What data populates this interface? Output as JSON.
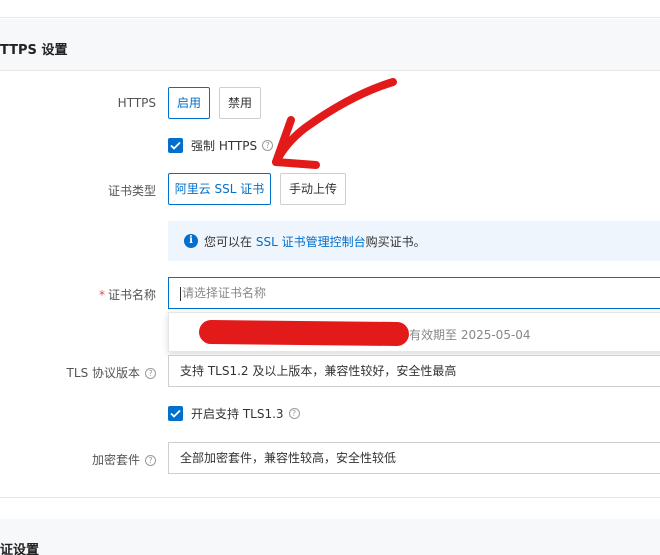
{
  "https_section": {
    "title": "TTPS 设置",
    "https_label": "HTTPS",
    "enable_button": "启用",
    "disable_button": "禁用",
    "force_https_label": "强制 HTTPS",
    "cert_type_label": "证书类型",
    "cert_type_aliyun": "阿里云 SSL 证书",
    "cert_type_manual": "手动上传",
    "info_prefix": "您可以在",
    "info_link": "SSL 证书管理控制台",
    "info_suffix": "购买证书。",
    "cert_name_required": "*",
    "cert_name_label": "证书名称",
    "cert_name_placeholder": "请选择证书名称",
    "cert_option_expiry": "有效期至 2025-05-04",
    "tls_label": "TLS 协议版本",
    "tls_value": "支持 TLS1.2 及以上版本，兼容性较好，安全性最高",
    "tls13_label": "开启支持 TLS1.3",
    "cipher_label": "加密套件",
    "cipher_value": "全部加密套件，兼容性较高，安全性较低"
  },
  "auth_section": {
    "title": "证设置"
  },
  "icons": {
    "help": "question-circle-icon",
    "info": "info-circle-icon",
    "check": "checkmark-icon"
  },
  "colors": {
    "accent": "#0070cc",
    "annotation_red": "#e21a1a",
    "info_bg": "#eff5fd",
    "section_bg": "#f7f8fa"
  }
}
